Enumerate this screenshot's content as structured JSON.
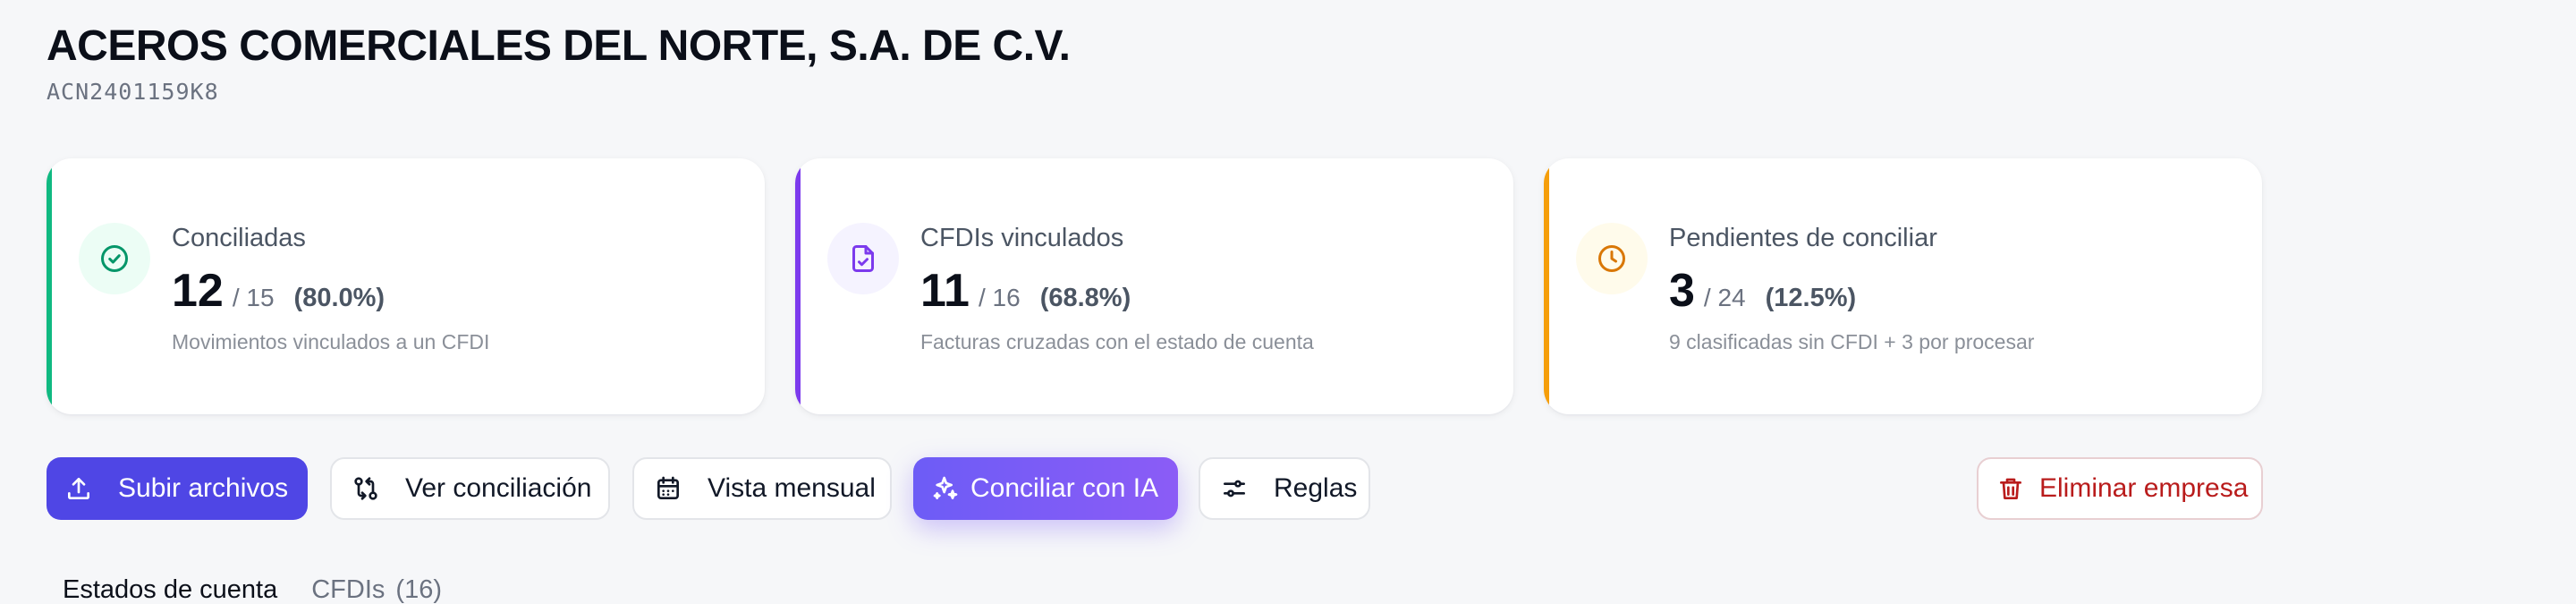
{
  "company": {
    "name": "ACEROS COMERCIALES DEL NORTE, S.A. DE C.V.",
    "rfc": "ACN2401159K8"
  },
  "cards": [
    {
      "label": "Conciliadas",
      "value": "12",
      "total": "/ 15",
      "percent": "(80.0%)",
      "description": "Movimientos vinculados a un CFDI",
      "icon": "check-circle-icon",
      "accent_color": "#10b981"
    },
    {
      "label": "CFDIs vinculados",
      "value": "11",
      "total": "/ 16",
      "percent": "(68.8%)",
      "description": "Facturas cruzadas con el estado de cuenta",
      "icon": "file-check-icon",
      "accent_color": "#7c3aed"
    },
    {
      "label": "Pendientes de conciliar",
      "value": "3",
      "total": "/ 24",
      "percent": "(12.5%)",
      "description": "9 clasificadas sin CFDI + 3 por procesar",
      "icon": "clock-icon",
      "accent_color": "#f59e0b"
    }
  ],
  "toolbar": {
    "upload_label": "Subir archivos",
    "reconciliation_label": "Ver conciliación",
    "monthly_label": "Vista mensual",
    "ai_label": "Conciliar con IA",
    "rules_label": "Reglas",
    "delete_label": "Eliminar empresa"
  },
  "tabs": [
    {
      "label": "Estados de cuenta",
      "count": ""
    },
    {
      "label": "CFDIs",
      "count": "(16)"
    }
  ],
  "colors": {
    "primary": "#4f46e5",
    "ai_gradient_start": "#6d5cf6",
    "ai_gradient_end": "#8b5cf6",
    "danger": "#b91c1c",
    "success": "#10b981",
    "purple": "#7c3aed",
    "warning": "#f59e0b"
  }
}
